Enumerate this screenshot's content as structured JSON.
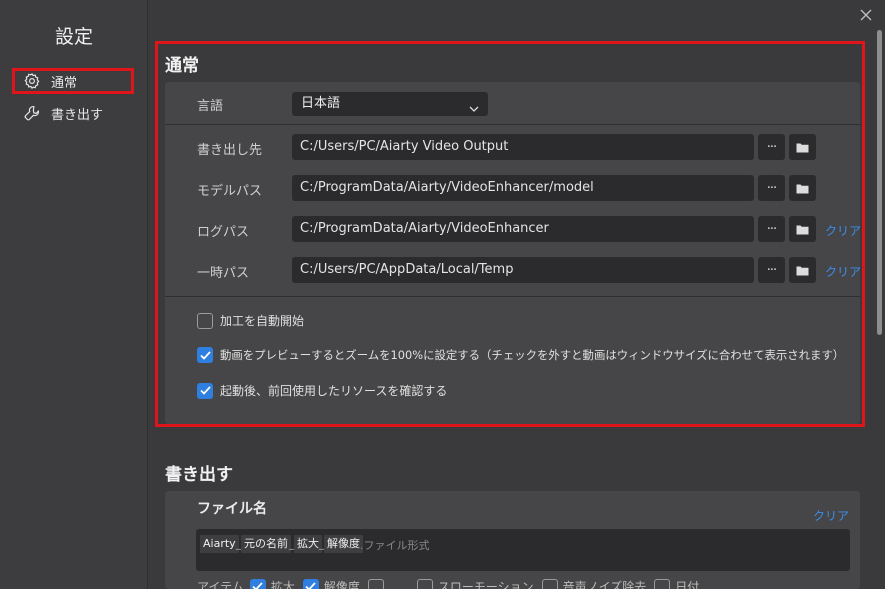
{
  "sidebar": {
    "title": "設定",
    "items": [
      {
        "label": "通常",
        "icon": "gear-icon",
        "active": true
      },
      {
        "label": "書き出す",
        "icon": "wrench-icon",
        "active": false
      }
    ]
  },
  "general": {
    "title": "通常",
    "language": {
      "label": "言語",
      "value": "日本語"
    },
    "paths": [
      {
        "label": "書き出し先",
        "value": "C:/Users/PC/Aiarty Video Output",
        "clear": ""
      },
      {
        "label": "モデルパス",
        "value": "C:/ProgramData/Aiarty/VideoEnhancer/model",
        "clear": ""
      },
      {
        "label": "ログパス",
        "value": "C:/ProgramData/Aiarty/VideoEnhancer",
        "clear": "クリア"
      },
      {
        "label": "一時パス",
        "value": "C:/Users/PC/AppData/Local/Temp",
        "clear": "クリア"
      }
    ],
    "more_label": "···",
    "checkboxes": [
      {
        "label": "加工を自動開始",
        "checked": false
      },
      {
        "label": "動画をプレビューするとズームを100%に設定する（チェックを外すと動画はウィンドウサイズに合わせて表示されます）",
        "checked": true
      },
      {
        "label": "起動後、前回使用したリソースを確認する",
        "checked": true
      }
    ]
  },
  "export": {
    "title": "書き出す",
    "filename_label": "ファイル名",
    "clear": "クリア",
    "tokens": [
      "Aiarty",
      "元の名前",
      "拡大",
      "解像度"
    ],
    "separator": "_",
    "format_placeholder": ".ファイル形式",
    "items_label": "アイテム",
    "items": [
      {
        "label": "拡大",
        "checked": true
      },
      {
        "label": "解像度",
        "checked": true
      },
      {
        "label": "",
        "checked": false
      },
      {
        "label": "スローモーション",
        "checked": false
      },
      {
        "label": "音声ノイズ除去",
        "checked": false
      },
      {
        "label": "日付",
        "checked": false
      }
    ]
  },
  "colors": {
    "accent": "#2f7fe0",
    "highlight": "#e0141b",
    "link": "#3b8eea"
  }
}
